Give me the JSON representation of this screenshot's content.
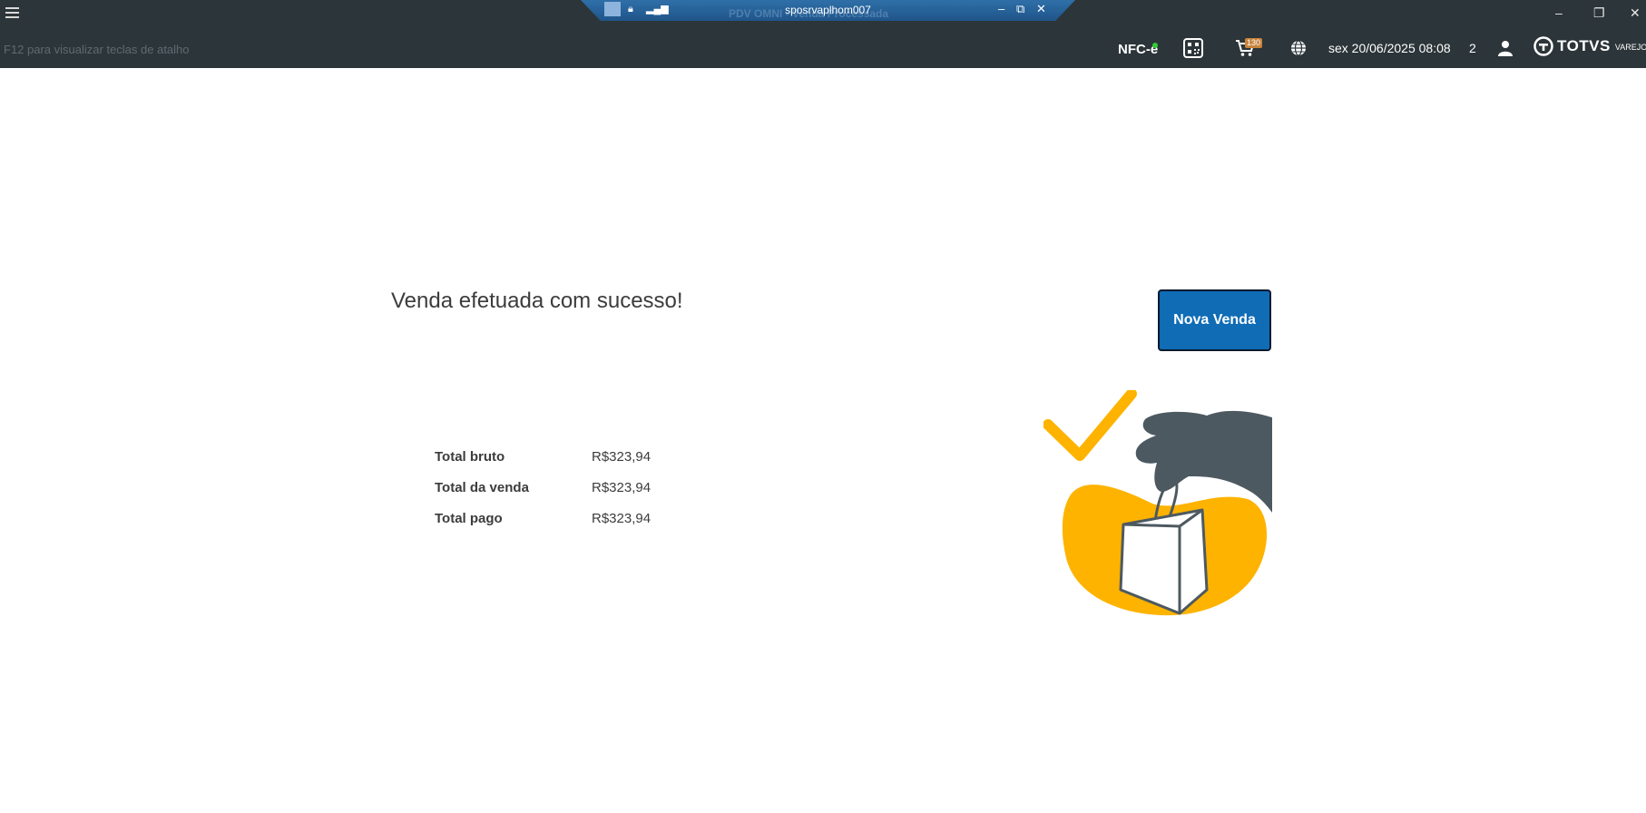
{
  "rdp": {
    "host": "sposrvaplhom007",
    "ghost_title": "PDV OMNI - Venda Processada",
    "minimize": "–",
    "restore": "⧉",
    "close": "✕"
  },
  "window": {
    "minimize": "–",
    "restore": "❐",
    "close": "✕"
  },
  "header": {
    "hint": "F12 para visualizar teclas de atalho",
    "nfce_label": "NFC-e",
    "cart_count": "130",
    "datetime": "sex 20/06/2025 08:08",
    "counter": "2",
    "brand": "TOTVS",
    "brand_sub": "VAREJO"
  },
  "main": {
    "message": "Venda efetuada com sucesso!",
    "new_sale_button": "Nova Venda",
    "totals": [
      {
        "label": "Total bruto",
        "value": "R$323,94"
      },
      {
        "label": "Total da venda",
        "value": "R$323,94"
      },
      {
        "label": "Total pago",
        "value": "R$323,94"
      }
    ]
  },
  "colors": {
    "header_bg": "#2c3539",
    "accent": "#0f6cb5",
    "illustration_yellow": "#fdb300",
    "illustration_gray": "#4d5961"
  }
}
